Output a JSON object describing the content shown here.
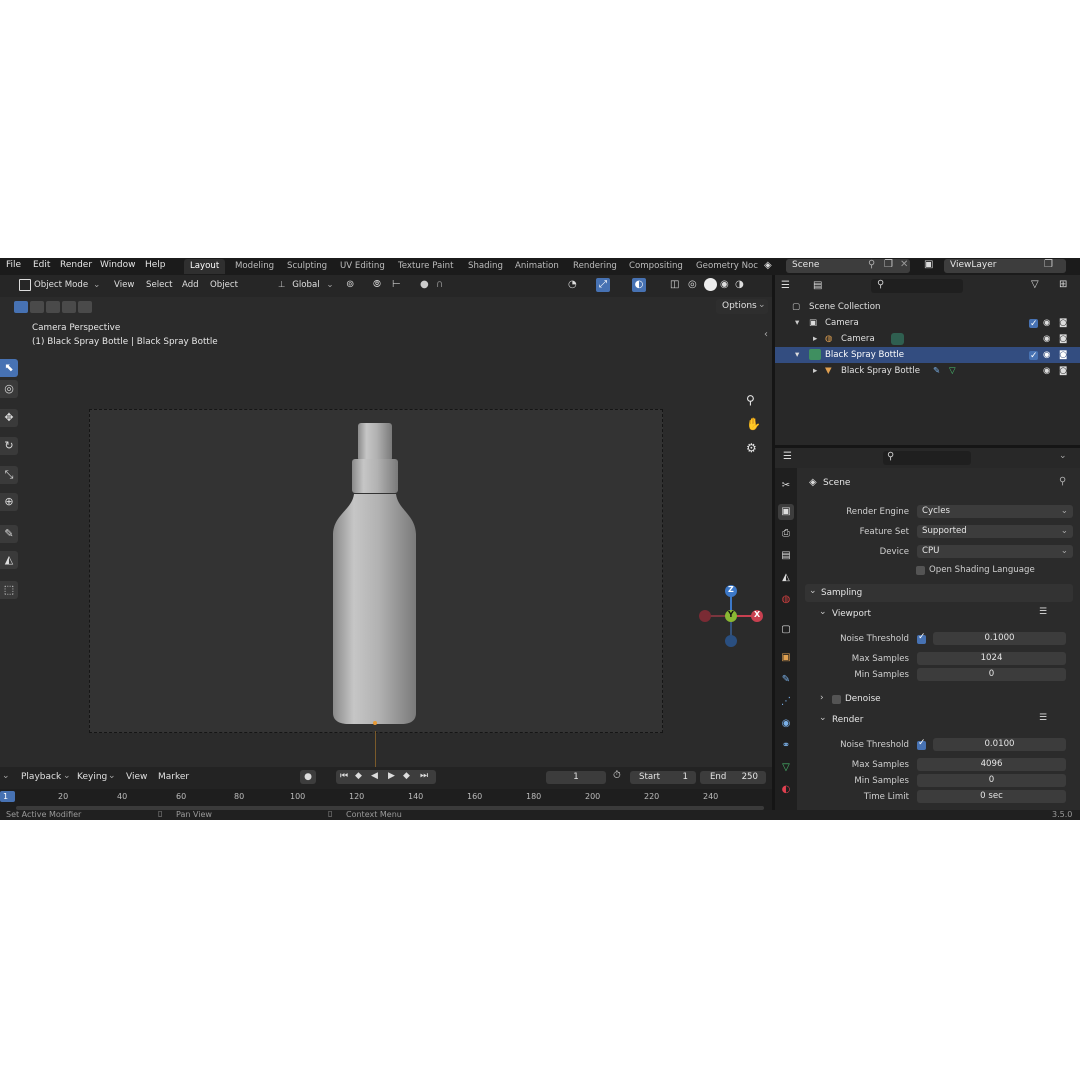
{
  "menu": {
    "file": "File",
    "edit": "Edit",
    "render": "Render",
    "window": "Window",
    "help": "Help"
  },
  "workspaces": [
    "Layout",
    "Modeling",
    "Sculpting",
    "UV Editing",
    "Texture Paint",
    "Shading",
    "Animation",
    "Rendering",
    "Compositing",
    "Geometry Noc"
  ],
  "scene_selector": {
    "scene": "Scene",
    "view_layer": "ViewLayer"
  },
  "viewport_header": {
    "mode": "Object Mode",
    "view": "View",
    "select": "Select",
    "add": "Add",
    "object": "Object",
    "orientation": "Global",
    "options": "Options"
  },
  "viewport": {
    "overlay_title": "Camera Perspective",
    "overlay_subtitle": "(1) Black Spray Bottle | Black Spray Bottle",
    "gizmo": {
      "z": "Z",
      "y": "Y",
      "x": "X"
    }
  },
  "outliner": {
    "rows": [
      {
        "label": "Scene Collection"
      },
      {
        "label": "Camera"
      },
      {
        "label": "Camera"
      },
      {
        "label": "Black Spray Bottle"
      },
      {
        "label": "Black Spray Bottle"
      }
    ]
  },
  "properties": {
    "context": "Scene",
    "render_engine_label": "Render Engine",
    "render_engine": "Cycles",
    "feature_set_label": "Feature Set",
    "feature_set": "Supported",
    "device_label": "Device",
    "device": "CPU",
    "osl_label": "Open Shading Language",
    "sampling": "Sampling",
    "viewport_panel": "Viewport",
    "v_noise_label": "Noise Threshold",
    "v_noise": "0.1000",
    "v_max_label": "Max Samples",
    "v_max": "1024",
    "v_min_label": "Min Samples",
    "v_min": "0",
    "denoise": "Denoise",
    "render_panel": "Render",
    "r_noise_label": "Noise Threshold",
    "r_noise": "0.0100",
    "r_max_label": "Max Samples",
    "r_max": "4096",
    "r_min_label": "Min Samples",
    "r_min": "0",
    "time_label": "Time Limit",
    "time": "0 sec"
  },
  "timeline": {
    "playback": "Playback",
    "keying": "Keying",
    "view": "View",
    "marker": "Marker",
    "current_frame": "1",
    "start_label": "Start",
    "start": "1",
    "end_label": "End",
    "end": "250",
    "ticks": [
      "1",
      "20",
      "40",
      "60",
      "80",
      "100",
      "120",
      "140",
      "160",
      "180",
      "200",
      "220",
      "240"
    ]
  },
  "status": {
    "left": "Set Active Modifier",
    "middle": "Pan View",
    "right": "Context Menu",
    "version": "3.5.0"
  },
  "colors": {
    "accent": "#4772b3",
    "selected_row": "#334d80",
    "bg": "#1d1d1d"
  }
}
